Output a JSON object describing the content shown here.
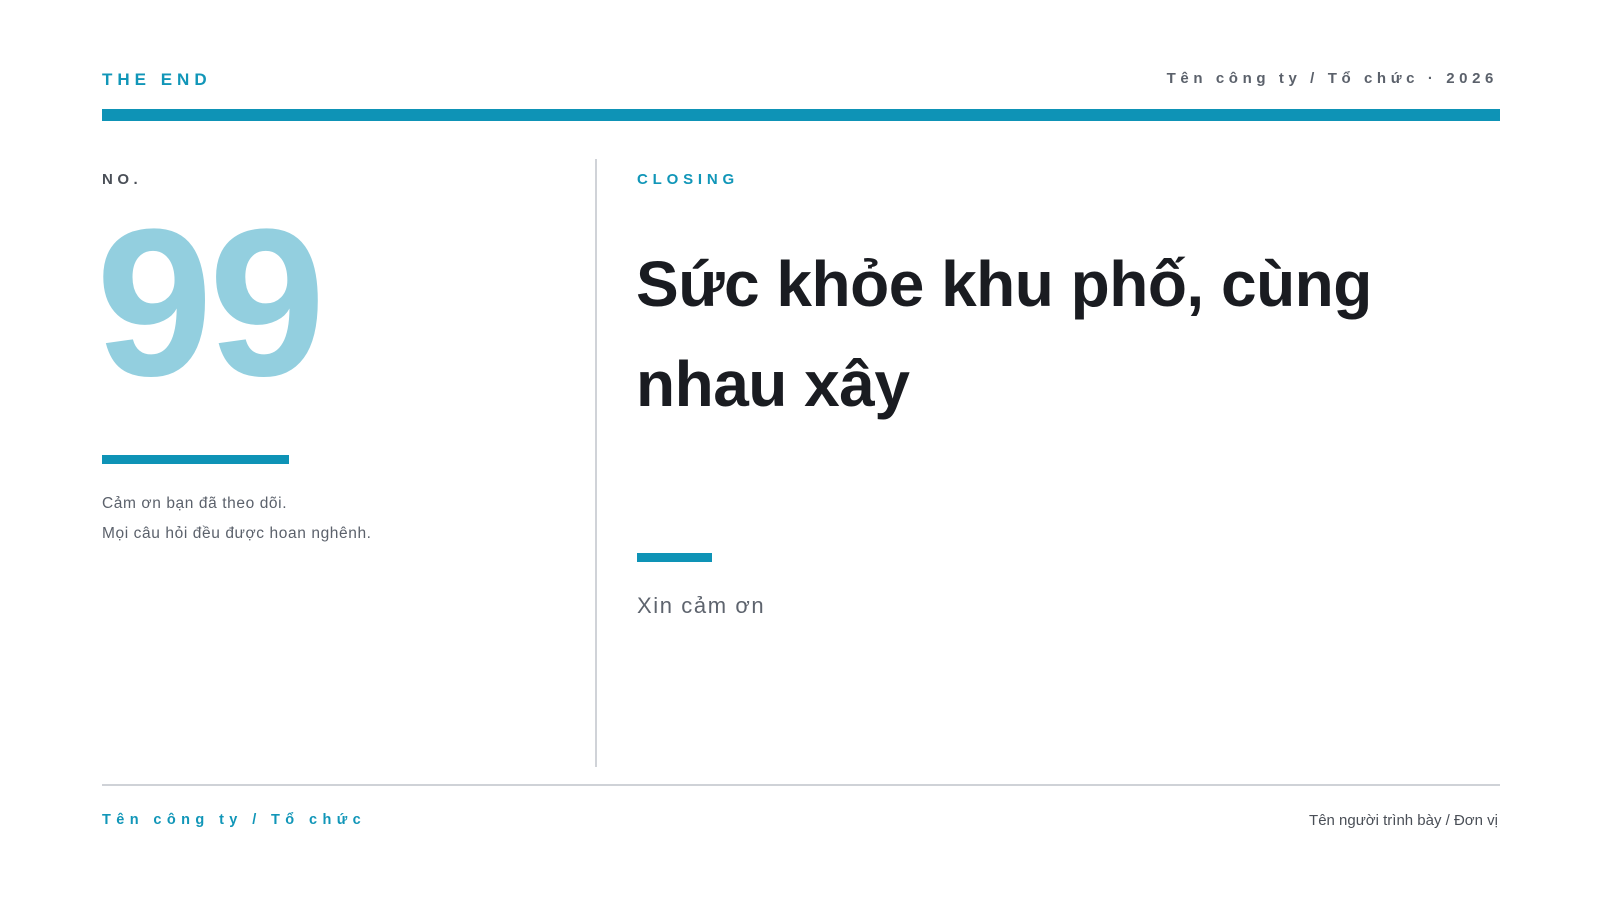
{
  "header": {
    "label": "THE END",
    "meta": "Tên công ty / Tổ chức · 2026"
  },
  "left": {
    "no_label": "NO.",
    "number": "99",
    "thanks_lines": [
      "Cảm ơn bạn đã theo dõi.",
      "Mọi câu hỏi đều được hoan nghênh."
    ]
  },
  "right": {
    "section_label": "CLOSING",
    "title": "Sức khỏe khu phố, cùng nhau xây",
    "subtitle": "Xin cảm ơn"
  },
  "footer": {
    "organization": "Tên công ty / Tổ chức",
    "presenter": "Tên người trình bày / Đơn vị"
  },
  "colors": {
    "accent": "#0e93b6",
    "number_tint": "#93cfdf",
    "title_text": "#1a1c21",
    "muted_text": "#5b616b",
    "rule_gray": "#cfd2d7"
  }
}
